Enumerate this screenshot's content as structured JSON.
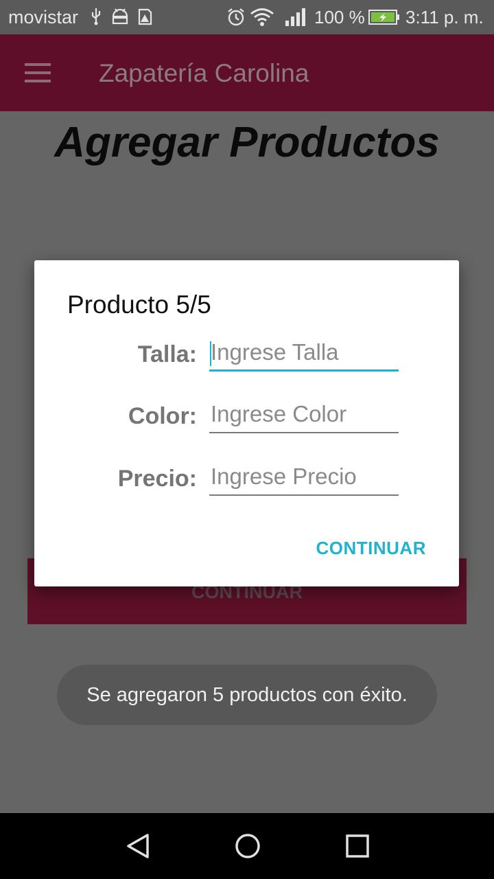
{
  "status_bar": {
    "carrier": "movistar",
    "battery_percent": "100 %",
    "time": "3:11 p. m.",
    "icons": [
      "usb-icon",
      "android-debug-icon",
      "storage-warning-icon",
      "alarm-icon",
      "wifi-icon",
      "signal-icon",
      "battery-charging-icon"
    ]
  },
  "app_bar": {
    "title": "Zapatería Carolina",
    "menu_icon": "hamburger-menu-icon"
  },
  "page": {
    "heading": "Agregar Productos",
    "continue_button": "CONTINUAR"
  },
  "dialog": {
    "title": "Producto 5/5",
    "fields": [
      {
        "label": "Talla:",
        "placeholder": "Ingrese Talla",
        "value": ""
      },
      {
        "label": "Color:",
        "placeholder": "Ingrese Color",
        "value": ""
      },
      {
        "label": "Precio:",
        "placeholder": "Ingrese Precio",
        "value": ""
      }
    ],
    "action": "CONTINUAR"
  },
  "toast": {
    "message": "Se agregaron 5 productos con éxito."
  },
  "nav_bar": {
    "icons": [
      "back-icon",
      "home-icon",
      "recents-icon"
    ]
  },
  "colors": {
    "app_bar": "#5f0e2a",
    "accent": "#1eb3cf",
    "scrim": "#656565"
  }
}
